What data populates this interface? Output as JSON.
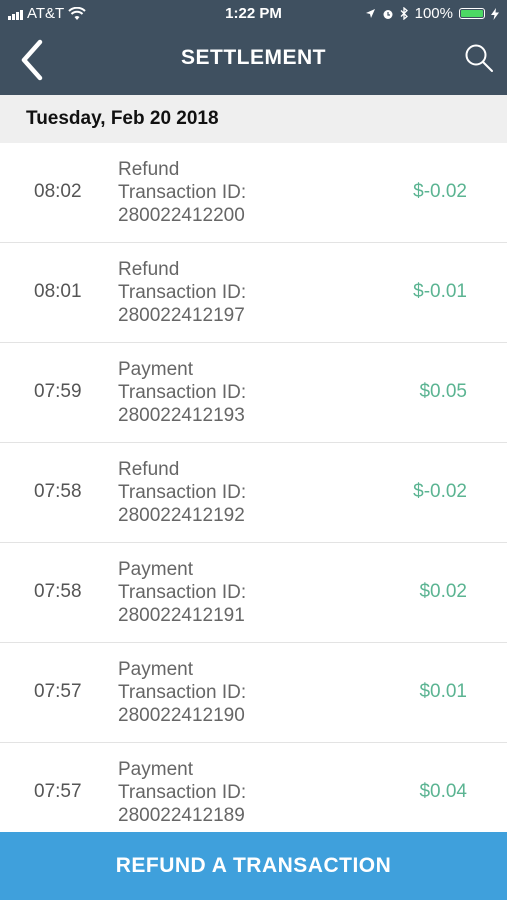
{
  "status_bar": {
    "carrier": "AT&T",
    "time": "1:22 PM",
    "battery": "100%",
    "battery_level": 1.0
  },
  "header": {
    "title": "SETTLEMENT",
    "back_icon": "chevron-left-icon",
    "search_icon": "search-icon"
  },
  "date_header": "Tuesday, Feb 20 2018",
  "transactions": [
    {
      "time": "08:02",
      "type": "Refund",
      "id_label": "Transaction ID:",
      "id": "280022412200",
      "amount": "$-0.02"
    },
    {
      "time": "08:01",
      "type": "Refund",
      "id_label": "Transaction ID:",
      "id": "280022412197",
      "amount": "$-0.01"
    },
    {
      "time": "07:59",
      "type": "Payment",
      "id_label": "Transaction ID:",
      "id": "280022412193",
      "amount": "$0.05"
    },
    {
      "time": "07:58",
      "type": "Refund",
      "id_label": "Transaction ID:",
      "id": "280022412192",
      "amount": "$-0.02"
    },
    {
      "time": "07:58",
      "type": "Payment",
      "id_label": "Transaction ID:",
      "id": "280022412191",
      "amount": "$0.02"
    },
    {
      "time": "07:57",
      "type": "Payment",
      "id_label": "Transaction ID:",
      "id": "280022412190",
      "amount": "$0.01"
    },
    {
      "time": "07:57",
      "type": "Payment",
      "id_label": "Transaction ID:",
      "id": "280022412189",
      "amount": "$0.04"
    }
  ],
  "footer": {
    "button_label": "REFUND A TRANSACTION"
  },
  "colors": {
    "header_bg": "#3f5060",
    "amount": "#5bb492",
    "footer_bg": "#3fa0dc",
    "battery": "#4cd964"
  }
}
